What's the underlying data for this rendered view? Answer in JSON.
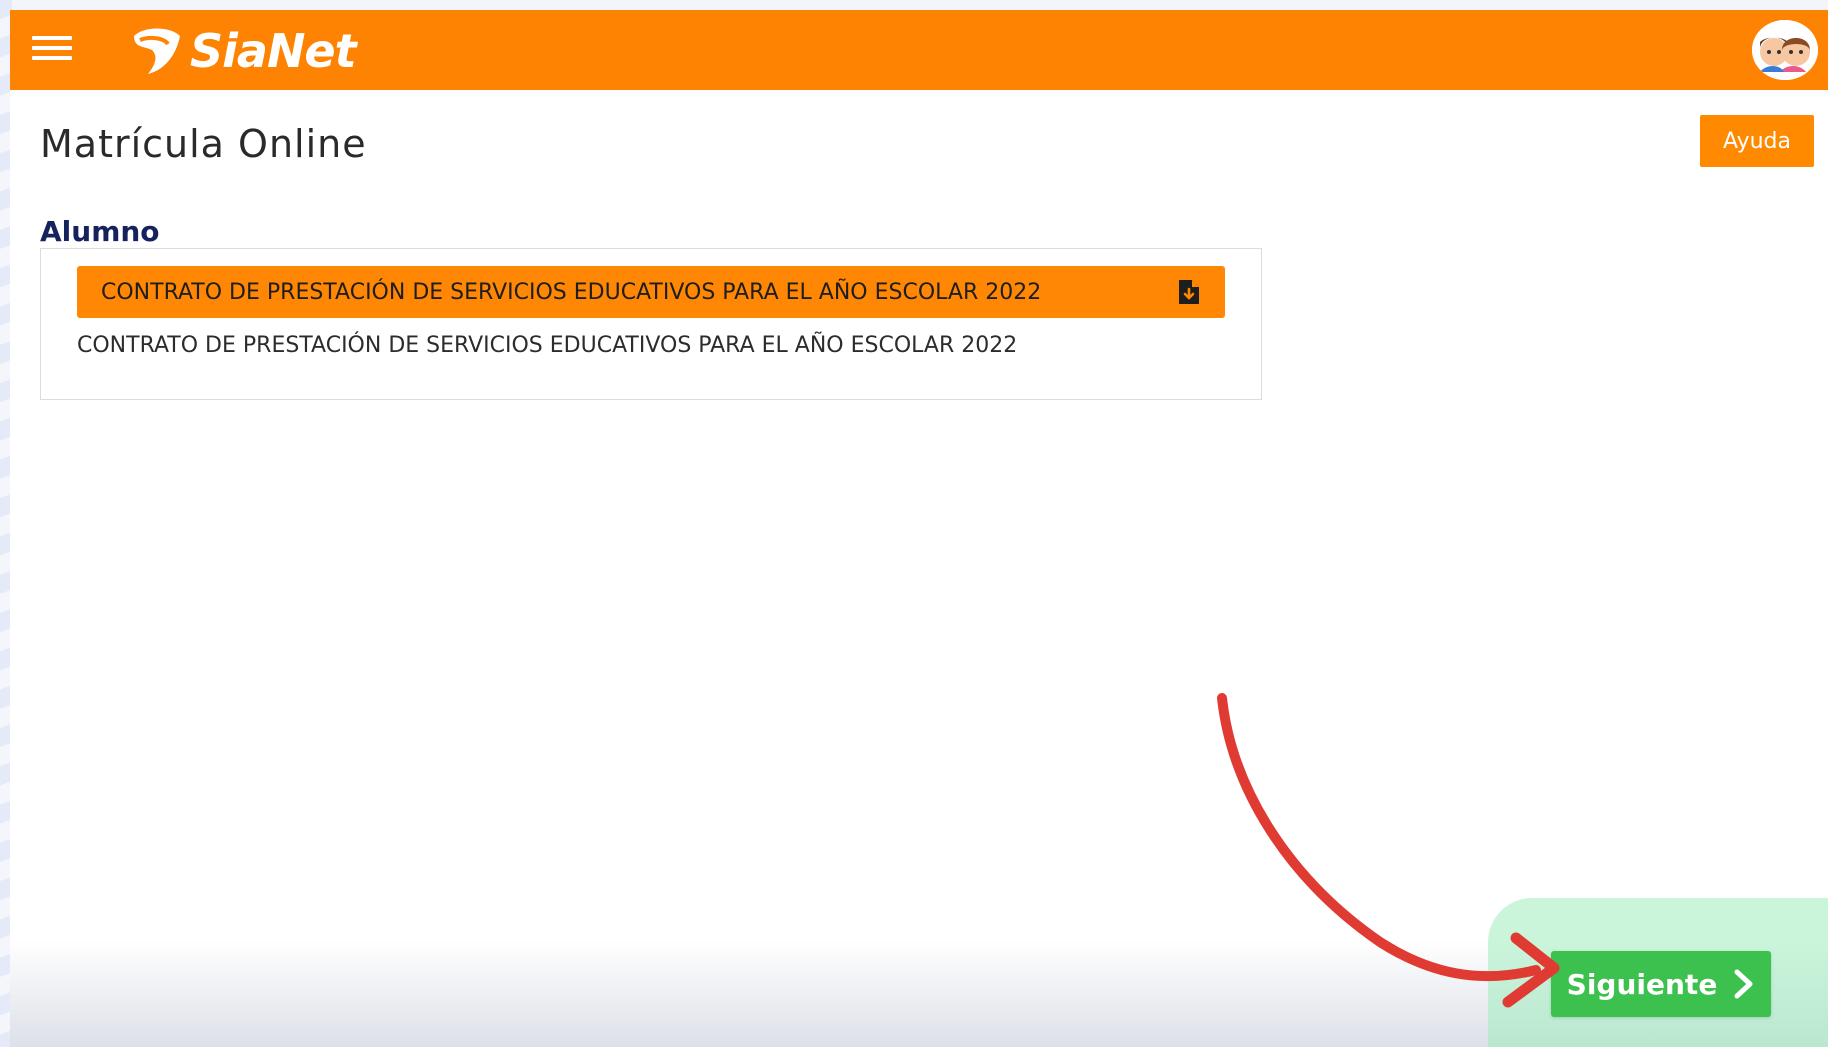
{
  "header": {
    "app_name": "SiaNet",
    "icons": [
      "menu-icon",
      "sianet-logo-icon",
      "user-avatar-icon"
    ],
    "bar_color": "#ff8303"
  },
  "page": {
    "title": "Matrícula Online",
    "help_label": "Ayuda"
  },
  "section": {
    "label": "Alumno",
    "document_button_label": "CONTRATO DE PRESTACIÓN DE SERVICIOS EDUCATIVOS PARA EL AÑO ESCOLAR 2022",
    "document_button_icon": "file-download-icon",
    "document_description": "CONTRATO DE PRESTACIÓN DE SERVICIOS EDUCATIVOS PARA EL AÑO ESCOLAR 2022"
  },
  "footer": {
    "next_label": "Siguiente",
    "next_icon": "chevron-right-icon",
    "next_color": "#3cc14e"
  },
  "annotation": {
    "arrow_icon": "curved-red-arrow-icon",
    "arrow_color": "#e03b33"
  }
}
